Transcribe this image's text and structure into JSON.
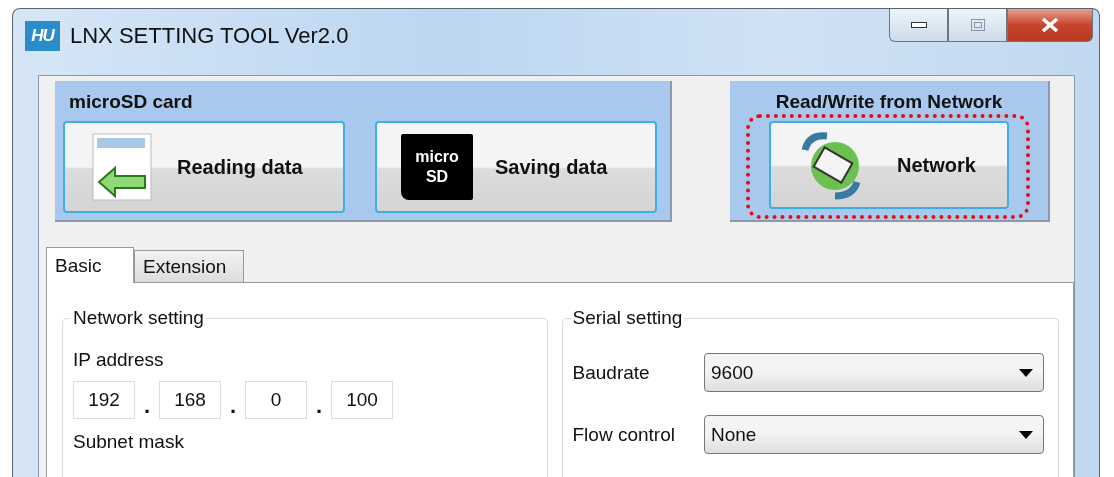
{
  "window": {
    "logo_text": "HU",
    "title": "LNX SETTING TOOL Ver2.0"
  },
  "microsd_panel": {
    "title": "microSD card",
    "buttons": [
      {
        "kind": "read",
        "label": "Reading data"
      },
      {
        "kind": "save",
        "label": "Saving data",
        "icon_text": [
          "micro",
          "SD"
        ]
      }
    ]
  },
  "network_panel": {
    "title": "Read/Write from Network",
    "button": {
      "label": "Network",
      "highlighted": true
    }
  },
  "tabs": [
    {
      "label": "Basic",
      "selected": true
    },
    {
      "label": "Extension",
      "selected": false
    }
  ],
  "network_setting": {
    "title": "Network setting",
    "ip_label": "IP address",
    "ip_octets": [
      "192",
      "168",
      "0",
      "100"
    ],
    "separator": ".",
    "subnet_label": "Subnet mask"
  },
  "serial_setting": {
    "title": "Serial setting",
    "rows": [
      {
        "label": "Baudrate",
        "value": "9600"
      },
      {
        "label": "Flow control",
        "value": "None"
      }
    ]
  }
}
